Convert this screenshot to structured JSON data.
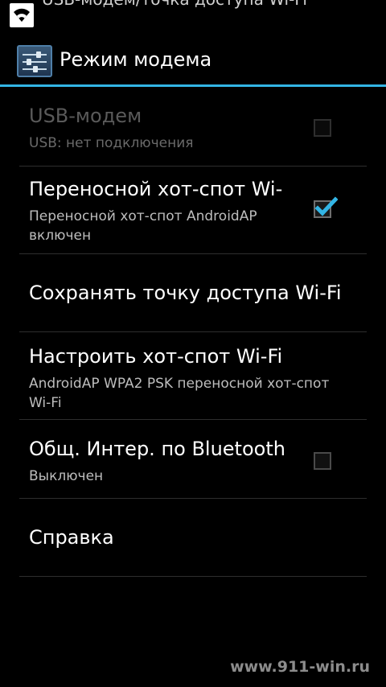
{
  "status_bar": {
    "notification_text": "USB-модем/точка доступа Wi-Fi",
    "icon": "wifi-hotspot-icon"
  },
  "action_bar": {
    "title": "Режим модема",
    "icon": "settings-sliders-icon"
  },
  "settings": [
    {
      "title": "USB-модем",
      "summary": "USB: нет подключения",
      "checkbox": true,
      "checked": false,
      "enabled": false
    },
    {
      "title": "Переносной хот-спот Wi-",
      "summary": "Переносной хот-спот AndroidAP включен",
      "checkbox": true,
      "checked": true,
      "enabled": true
    },
    {
      "title": "Сохранять точку доступа Wi-Fi",
      "summary": "",
      "checkbox": false,
      "enabled": true
    },
    {
      "title": "Настроить хот-спот Wi-Fi",
      "summary": "AndroidAP WPA2 PSK переносной хот-спот Wi-Fi",
      "checkbox": false,
      "enabled": true
    },
    {
      "title": "Общ. Интер. по Bluetooth",
      "summary": "Выключен",
      "checkbox": true,
      "checked": false,
      "enabled": true
    },
    {
      "title": "Справка",
      "summary": "",
      "checkbox": false,
      "enabled": true
    }
  ],
  "watermark": "www.911-win.ru",
  "colors": {
    "accent": "#33b5e5",
    "background": "#000000"
  }
}
